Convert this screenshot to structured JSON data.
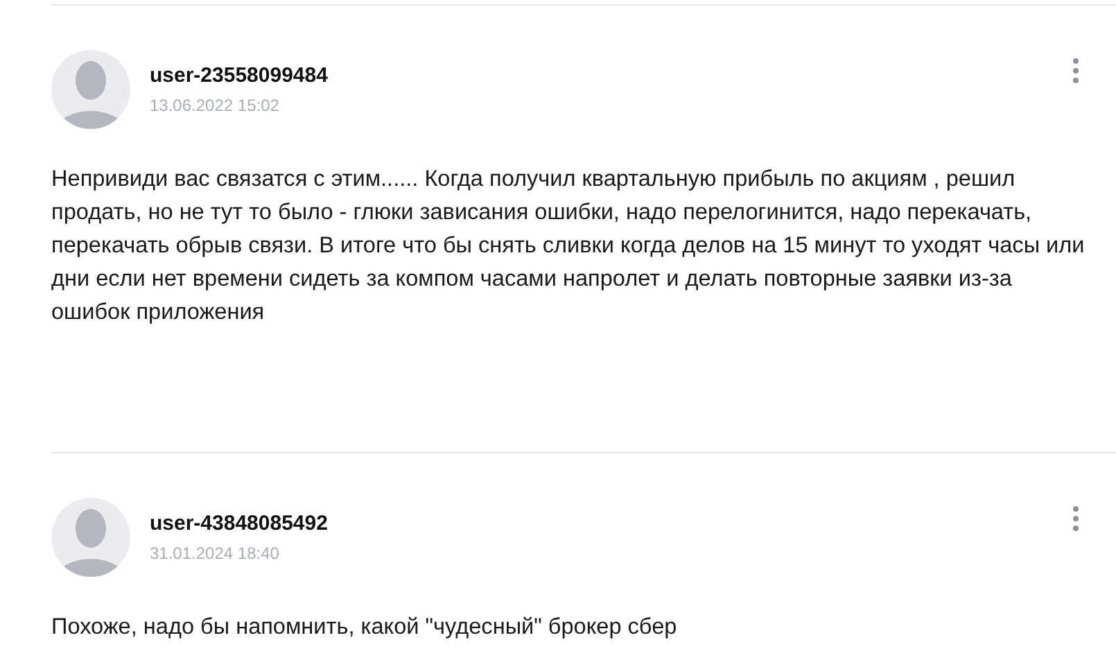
{
  "comments": [
    {
      "author": "user-23558099484",
      "date": "13.06.2022 15:02",
      "text": "Непривиди вас связатся с этим...... Когда получил квартальную прибыль по акциям , решил продать, но не тут то было - глюки зависания ошибки, надо перелогинится, надо перекачать, перекачать обрыв связи. В итоге что бы снять сливки когда делов на 15 минут то уходят часы или дни если нет времени сидеть за компом часами напролет и делать повторные заявки из-за ошибок приложения"
    },
    {
      "author": "user-43848085492",
      "date": "31.01.2024 18:40",
      "text": "Похоже, надо бы напомнить, какой \"чудесный\" брокер сбер"
    }
  ]
}
